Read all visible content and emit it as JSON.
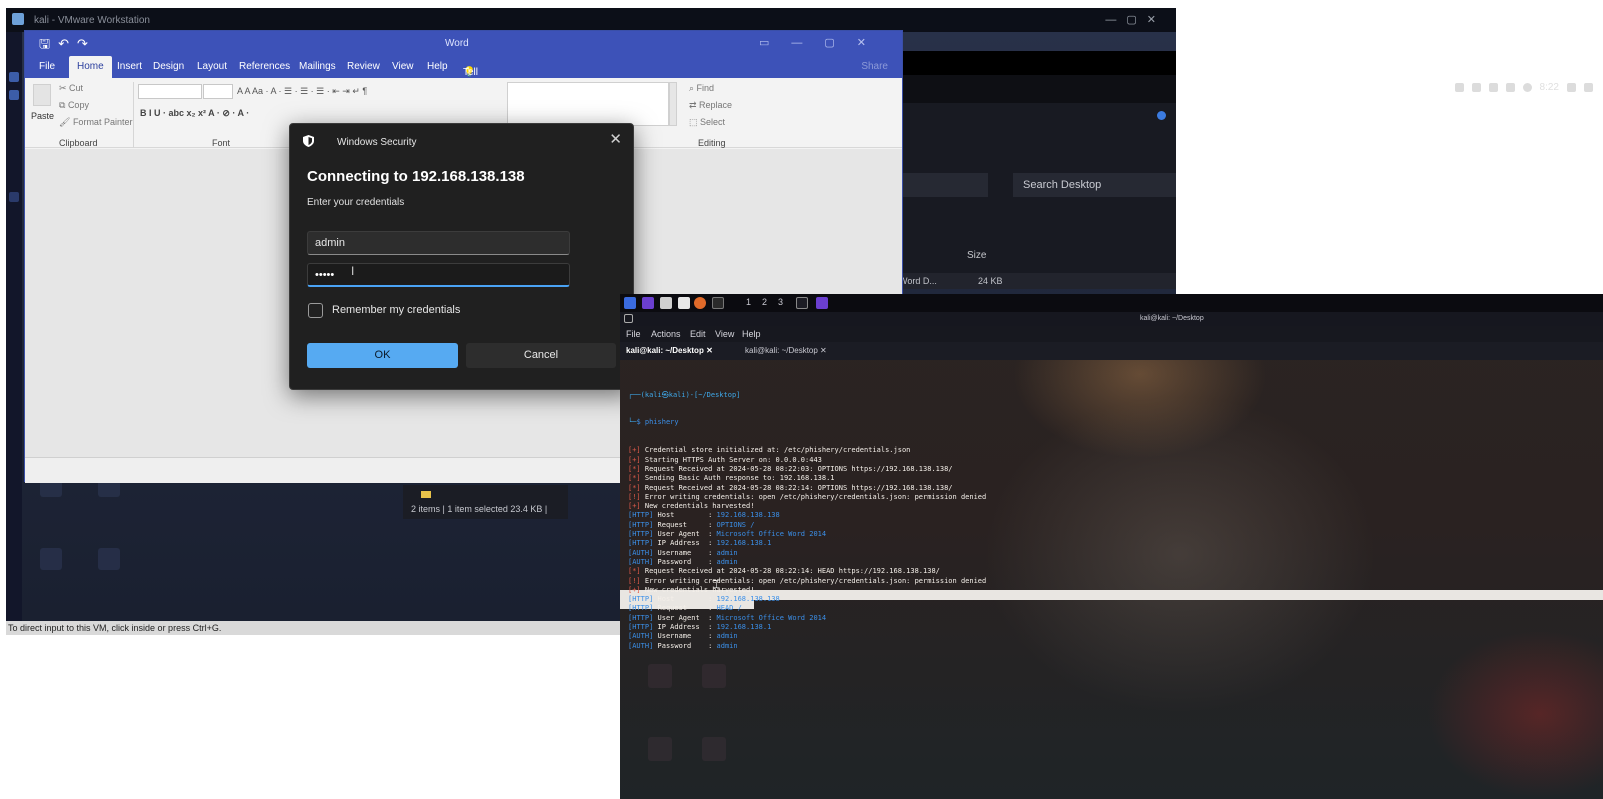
{
  "vmware": {
    "title": "kali - VMware Workstation",
    "status": "To direct input to this VM, click inside or press Ctrl+G."
  },
  "word": {
    "title": "Word",
    "tabs": [
      "File",
      "Home",
      "Insert",
      "Design",
      "Layout",
      "References",
      "Mailings",
      "Review",
      "View",
      "Help"
    ],
    "tell_me": "Tell me what you want to do",
    "share": "Share",
    "clipboard": {
      "paste": "Paste",
      "cut": "Cut",
      "copy": "Copy",
      "format_painter": "Format Painter",
      "group": "Clipboard"
    },
    "font_group": "Font",
    "editing": {
      "find": "Find",
      "replace": "Replace",
      "select": "Select",
      "group": "Editing"
    }
  },
  "dialog": {
    "header": "Windows Security",
    "title": "Connecting to 192.168.138.138",
    "subtitle": "Enter your credentials",
    "username": "admin",
    "password_mask": "•••••",
    "remember": "Remember my credentials",
    "ok": "OK",
    "cancel": "Cancel"
  },
  "file_manager": {
    "search_placeholder": "Search Desktop",
    "col_size": "Size",
    "row_name": "soft Word D...",
    "row_size": "24 KB",
    "status": "2 items  |  1 item selected  23.4 KB  |"
  },
  "kali_panel": {
    "time": "8:22"
  },
  "terminal": {
    "window_title": "kali@kali: ~/Desktop",
    "menu": [
      "File",
      "Actions",
      "Edit",
      "View",
      "Help"
    ],
    "tabs": [
      "kali@kali: ~/Desktop",
      "kali@kali: ~/Desktop"
    ],
    "workspaces": [
      "1",
      "2",
      "3"
    ],
    "prompt_user": "(kali㉿kali)-[~/Desktop]",
    "command": "phishery",
    "lines": [
      {
        "tag": "[+]",
        "text": " Credential store initialized at: /etc/phishery/credentials.json"
      },
      {
        "tag": "[+]",
        "text": " Starting HTTPS Auth Server on: 0.0.0.0:443"
      },
      {
        "tag": "[*]",
        "text": " Request Received at 2024-05-28 08:22:03: OPTIONS https://192.168.138.138/"
      },
      {
        "tag": "[*]",
        "text": " Sending Basic Auth response to: 192.168.138.1"
      },
      {
        "tag": "[*]",
        "text": " Request Received at 2024-05-28 08:22:14: OPTIONS https://192.168.138.138/"
      },
      {
        "tag": "[!]",
        "text": " Error writing credentials: open /etc/phishery/credentials.json: permission denied"
      },
      {
        "tag": "[+]",
        "text": " New credentials harvested!"
      },
      {
        "tag": "[HTTP]",
        "key": " Host        : ",
        "val": "192.168.138.138"
      },
      {
        "tag": "[HTTP]",
        "key": " Request     : ",
        "val": "OPTIONS /"
      },
      {
        "tag": "[HTTP]",
        "key": " User Agent  : ",
        "val": "Microsoft Office Word 2014"
      },
      {
        "tag": "[HTTP]",
        "key": " IP Address  : ",
        "val": "192.168.138.1"
      },
      {
        "tag": "[AUTH]",
        "key": " Username    : ",
        "val": "admin"
      },
      {
        "tag": "[AUTH]",
        "key": " Password    : ",
        "val": "admin"
      },
      {
        "tag": "[*]",
        "text": " Request Received at 2024-05-28 08:22:14: HEAD https://192.168.138.138/"
      },
      {
        "tag": "[!]",
        "text": " Error writing credentials: open /etc/phishery/credentials.json: permission denied"
      },
      {
        "tag": "[+]",
        "text": " New credentials harvested!"
      },
      {
        "tag": "[HTTP]",
        "key": " Host        : ",
        "val": "192.168.138.138"
      },
      {
        "tag": "[HTTP]",
        "key": " Request     : ",
        "val": "HEAD /"
      },
      {
        "tag": "[HTTP]",
        "key": " User Agent  : ",
        "val": "Microsoft Office Word 2014"
      },
      {
        "tag": "[HTTP]",
        "key": " IP Address  : ",
        "val": "192.168.138.1"
      },
      {
        "tag": "[AUTH]",
        "key": " Username    : ",
        "val": "admin"
      },
      {
        "tag": "[AUTH]",
        "key": " Password    : ",
        "val": "admin"
      }
    ]
  },
  "colors": {
    "word_blue": "#3d52b8",
    "dialog_bg": "#202020",
    "ok_blue": "#56aaf2",
    "term_bg": "#2a2221",
    "term_tag_red": "#e05a4a",
    "term_value_blue": "#3b8fe8"
  }
}
